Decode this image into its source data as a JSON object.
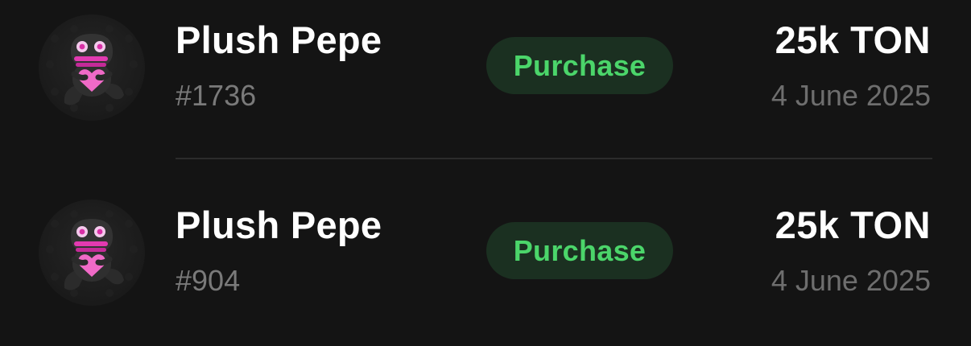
{
  "items": [
    {
      "title": "Plush Pepe",
      "number": "#1736",
      "action_label": "Purchase",
      "price": "25k TON",
      "date": "4 June 2025",
      "icon": "plush-pepe-icon"
    },
    {
      "title": "Plush Pepe",
      "number": "#904",
      "action_label": "Purchase",
      "price": "25k TON",
      "date": "4 June 2025",
      "icon": "plush-pepe-icon"
    }
  ],
  "colors": {
    "background": "#141414",
    "title": "#ffffff",
    "subtitle": "#7a7a7a",
    "badge_background": "#1b3021",
    "badge_text": "#4bd56a",
    "divider": "#2c2c2c",
    "pepe_pink": "#e23ab0"
  }
}
